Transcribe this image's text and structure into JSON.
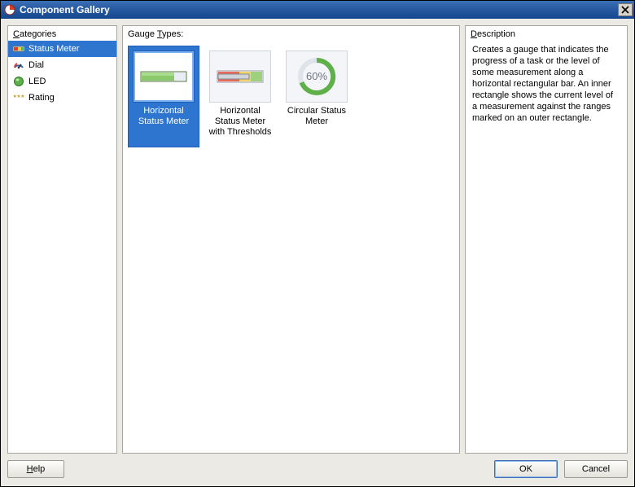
{
  "window": {
    "title": "Component Gallery"
  },
  "categories": {
    "title": "Categories",
    "items": [
      {
        "label": "Status Meter",
        "selected": true,
        "icon": "status-meter-icon"
      },
      {
        "label": "Dial",
        "selected": false,
        "icon": "dial-icon"
      },
      {
        "label": "LED",
        "selected": false,
        "icon": "led-icon"
      },
      {
        "label": "Rating",
        "selected": false,
        "icon": "rating-icon"
      }
    ]
  },
  "gaugeTypes": {
    "title": "Gauge Types:",
    "items": [
      {
        "label": "Horizontal Status Meter",
        "selected": true,
        "thumb": "hsm"
      },
      {
        "label": "Horizontal Status Meter with Thresholds",
        "selected": false,
        "thumb": "hsmt"
      },
      {
        "label": "Circular Status Meter",
        "selected": false,
        "thumb": "csm",
        "percentText": "60%"
      }
    ]
  },
  "description": {
    "title": "Description",
    "text": "Creates a gauge that indicates the progress of a task or the level of some measurement along a horizontal rectangular bar. An inner rectangle shows the current level of a measurement against the ranges marked on an outer rectangle."
  },
  "buttons": {
    "help": "Help",
    "ok": "OK",
    "cancel": "Cancel"
  }
}
